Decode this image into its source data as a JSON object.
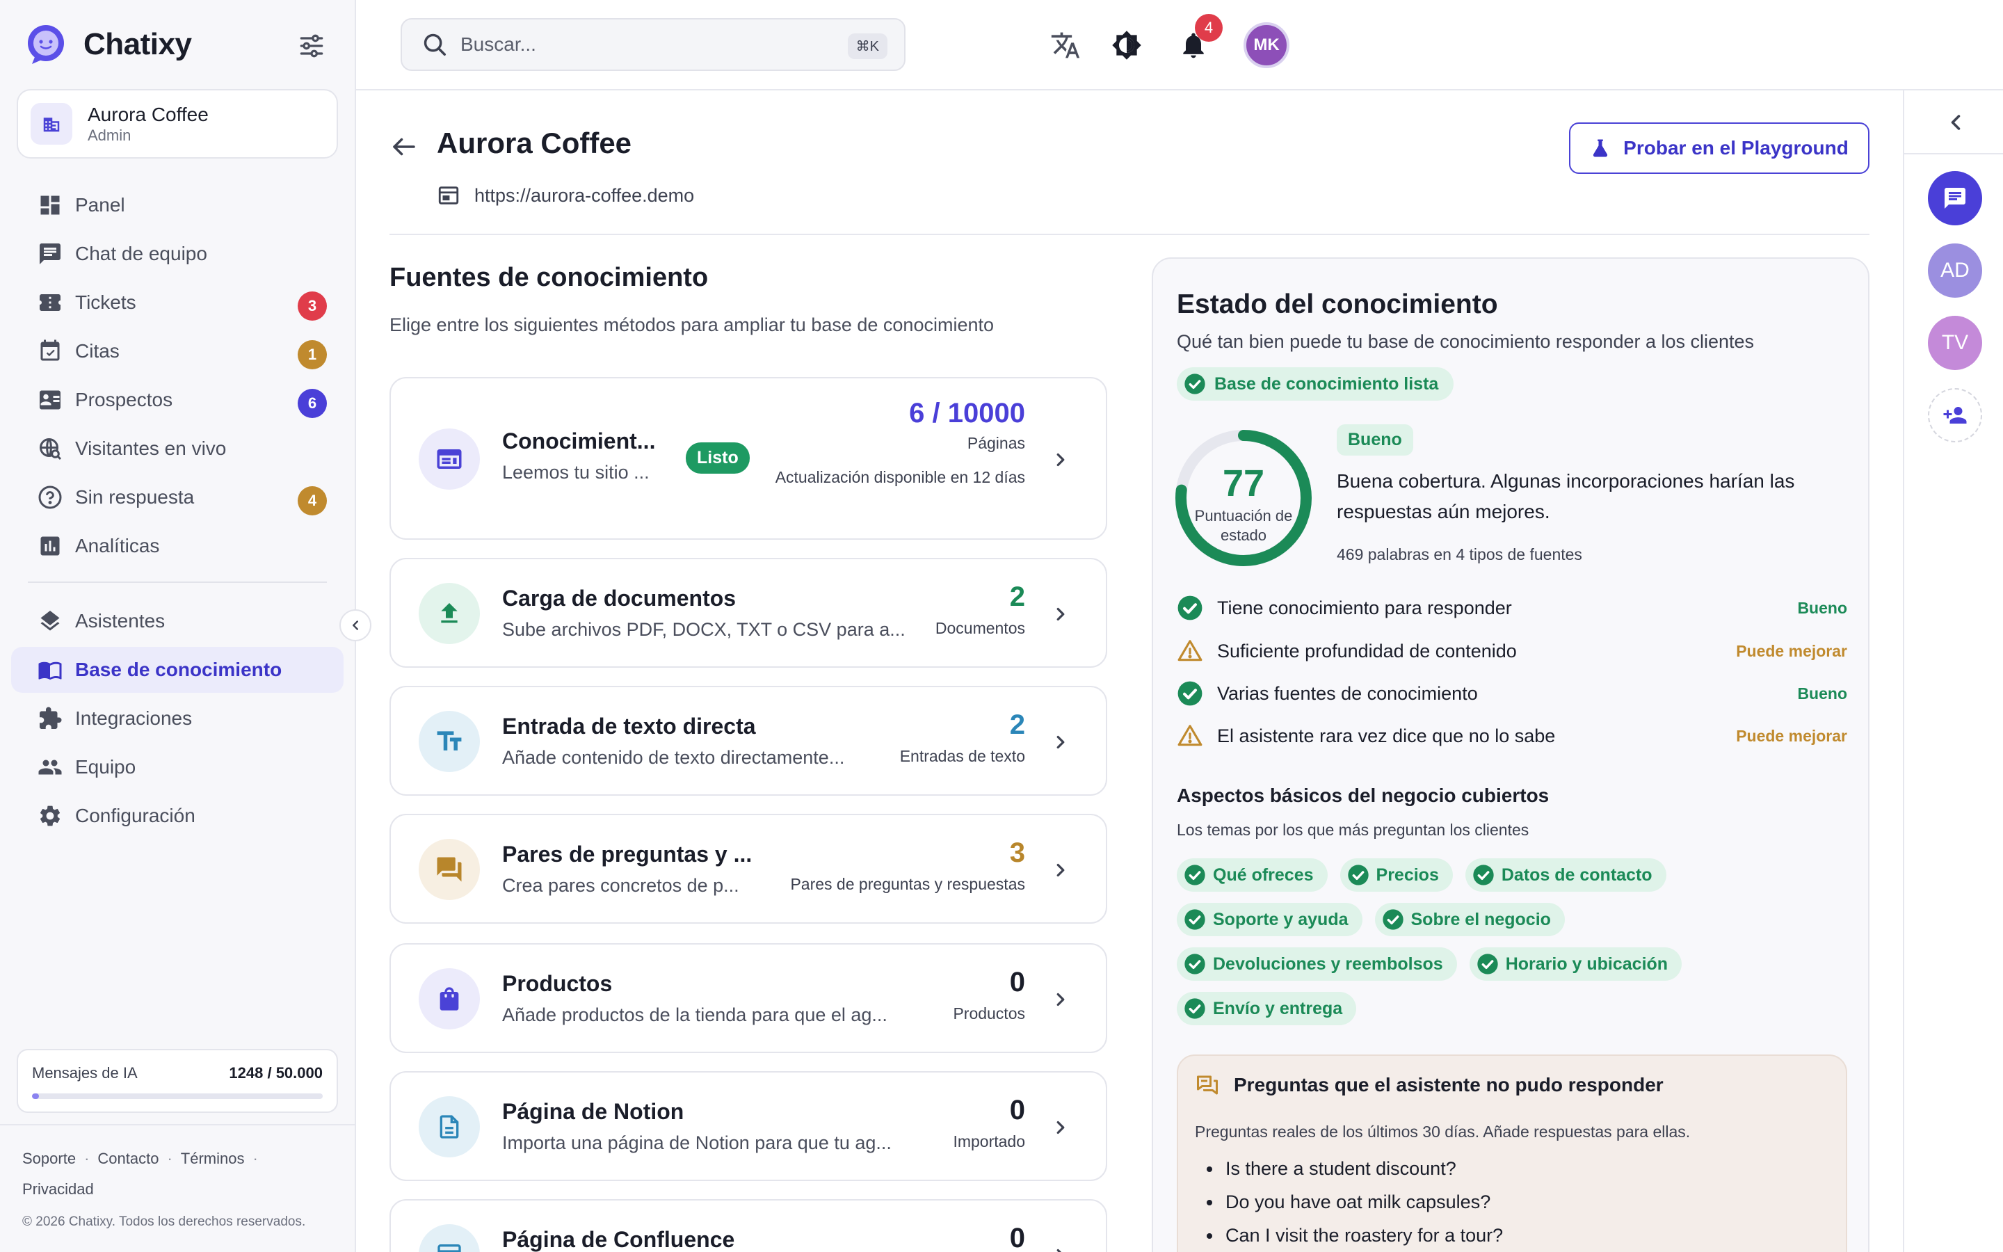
{
  "app": {
    "name": "Chatixy"
  },
  "org": {
    "name": "Aurora Coffee",
    "role": "Admin"
  },
  "nav": {
    "items": [
      {
        "label": "Panel",
        "icon": "dashboard-icon"
      },
      {
        "label": "Chat de equipo",
        "icon": "chat-icon"
      },
      {
        "label": "Tickets",
        "icon": "ticket-icon",
        "badge": "3",
        "badge_color": "#e03c4a"
      },
      {
        "label": "Citas",
        "icon": "calendar-icon",
        "badge": "1",
        "badge_color": "#c08a2e"
      },
      {
        "label": "Prospectos",
        "icon": "contact-card-icon",
        "badge": "6",
        "badge_color": "#4a3fd8"
      },
      {
        "label": "Visitantes en vivo",
        "icon": "live-visitors-icon"
      },
      {
        "label": "Sin respuesta",
        "icon": "help-circle-icon",
        "badge": "4",
        "badge_color": "#c08a2e"
      },
      {
        "label": "Analíticas",
        "icon": "analytics-icon"
      }
    ],
    "items2": [
      {
        "label": "Asistentes",
        "icon": "layers-icon"
      },
      {
        "label": "Base de conocimiento",
        "icon": "book-icon",
        "active": true
      },
      {
        "label": "Integraciones",
        "icon": "puzzle-icon"
      },
      {
        "label": "Equipo",
        "icon": "team-icon"
      },
      {
        "label": "Configuración",
        "icon": "gear-icon"
      }
    ]
  },
  "usage": {
    "label": "Mensajes de IA",
    "value": "1248 / 50.000",
    "fraction": 0.025
  },
  "footer": {
    "links": [
      "Soporte",
      "Contacto",
      "Términos",
      "Privacidad"
    ],
    "sep": "·",
    "copyright": "© 2026 Chatixy. Todos los derechos reservados."
  },
  "topbar": {
    "search_placeholder": "Buscar...",
    "search_shortcut": "⌘K",
    "notifications_count": "4",
    "user_initials": "MK"
  },
  "rail": {
    "avatars": [
      {
        "initials": "AD",
        "color": "#9b8fe0"
      },
      {
        "initials": "TV",
        "color": "#c48ad9"
      }
    ]
  },
  "page": {
    "title": "Aurora Coffee",
    "url": "https://aurora-coffee.demo",
    "playground_button": "Probar en el Playground"
  },
  "sources": {
    "title": "Fuentes de conocimiento",
    "subtitle": "Elige entre los siguientes métodos para ampliar tu base de conocimiento",
    "website": {
      "title": "Conocimient...",
      "desc": "Leemos tu sitio ...",
      "status": "Listo",
      "count": "6 / 10000",
      "unit": "Páginas",
      "update": "Actualización disponible en 12 días"
    },
    "cards": [
      {
        "title": "Carga de documentos",
        "desc": "Sube archivos PDF, DOCX, TXT o CSV para a...",
        "count": "2",
        "unit": "Documentos",
        "color": "#1b8a57",
        "icon_bg": "#e3f4ec",
        "icon": "upload-icon"
      },
      {
        "title": "Entrada de texto directa",
        "desc": "Añade contenido de texto directamente...",
        "count": "2",
        "unit": "Entradas de texto",
        "color": "#2b86b8",
        "icon_bg": "#e3f0f7",
        "icon": "text-icon"
      },
      {
        "title": "Pares de preguntas y ...",
        "desc": "Crea pares concretos de p...",
        "count": "3",
        "unit": "Pares de preguntas y respuestas",
        "color": "#b8862b",
        "icon_bg": "#f7efe2",
        "icon": "qa-icon"
      },
      {
        "title": "Productos",
        "desc": "Añade productos de la tienda para que el ag...",
        "count": "0",
        "unit": "Productos",
        "color": "#1a1d29",
        "icon_bg": "#ecebfb",
        "icon": "shopping-bag-icon"
      },
      {
        "title": "Página de Notion",
        "desc": "Importa una página de Notion para que tu ag...",
        "count": "0",
        "unit": "Importado",
        "color": "#1a1d29",
        "icon_bg": "#e3f0f7",
        "icon": "document-icon"
      },
      {
        "title": "Página de Confluence",
        "desc": "",
        "count": "0",
        "unit": "",
        "color": "#1a1d29",
        "icon_bg": "#e3f0f7",
        "icon": "confluence-icon"
      }
    ]
  },
  "status": {
    "title": "Estado del conocimiento",
    "subtitle": "Qué tan bien puede tu base de conocimiento responder a los clientes",
    "ready_label": "Base de conocimiento lista",
    "score": "77",
    "score_fraction": 0.77,
    "score_label": "Puntuación de estado",
    "rating": "Bueno",
    "rating_text": "Buena cobertura. Algunas incorporaciones harían las respuestas aún mejores.",
    "words_text": "469 palabras en 4 tipos de fuentes",
    "checks": [
      {
        "label": "Tiene conocimiento para responder",
        "status": "Bueno",
        "type": "good"
      },
      {
        "label": "Suficiente profundidad de contenido",
        "status": "Puede mejorar",
        "type": "warn"
      },
      {
        "label": "Varias fuentes de conocimiento",
        "status": "Bueno",
        "type": "good"
      },
      {
        "label": "El asistente rara vez dice que no lo sabe",
        "status": "Puede mejorar",
        "type": "warn"
      }
    ],
    "topics_title": "Aspectos básicos del negocio cubiertos",
    "topics_subtitle": "Los temas por los que más preguntan los clientes",
    "topics": [
      "Qué ofreces",
      "Precios",
      "Datos de contacto",
      "Soporte y ayuda",
      "Sobre el negocio",
      "Devoluciones y reembolsos",
      "Horario y ubicación",
      "Envío y entrega"
    ],
    "unanswered": {
      "title": "Preguntas que el asistente no pudo responder",
      "subtitle": "Preguntas reales de los últimos 30 días. Añade respuestas para ellas.",
      "questions": [
        "Is there a student discount?",
        "Do you have oat milk capsules?",
        "Can I visit the roastery for a tour?"
      ]
    }
  },
  "colors": {
    "accent": "#3b34c7",
    "success": "#1b8a57",
    "warning": "#c08a2e",
    "danger": "#e03c4a"
  }
}
